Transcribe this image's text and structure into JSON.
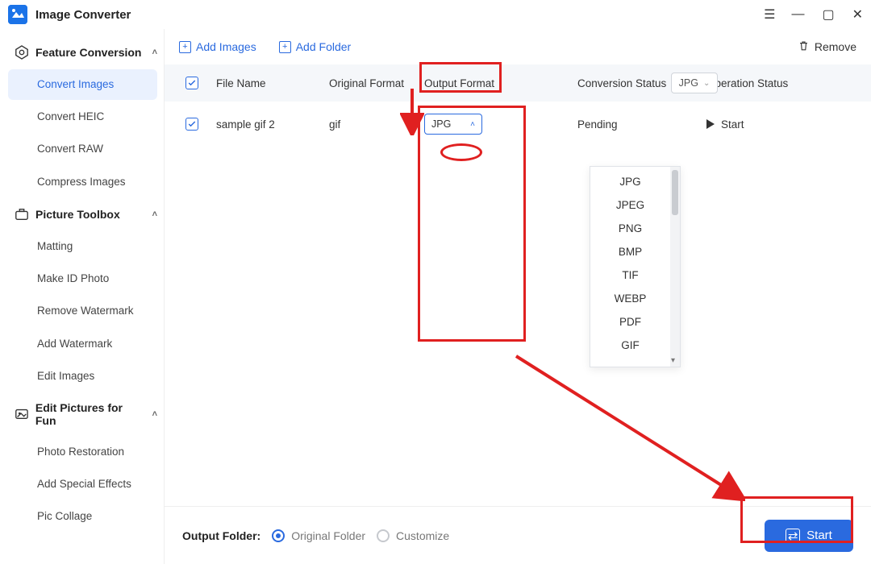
{
  "app": {
    "title": "Image Converter"
  },
  "sidebar": {
    "groups": [
      {
        "label": "Feature Conversion",
        "items": [
          "Convert Images",
          "Convert HEIC",
          "Convert RAW",
          "Compress Images"
        ],
        "active_index": 0
      },
      {
        "label": "Picture Toolbox",
        "items": [
          "Matting",
          "Make ID Photo",
          "Remove Watermark",
          "Add Watermark",
          "Edit Images"
        ]
      },
      {
        "label": "Edit Pictures for Fun",
        "items": [
          "Photo Restoration",
          "Add Special Effects",
          "Pic Collage"
        ]
      }
    ]
  },
  "toolbar": {
    "add_images": "Add Images",
    "add_folder": "Add Folder",
    "remove": "Remove"
  },
  "table": {
    "headers": {
      "file_name": "File Name",
      "original_format": "Original Format",
      "output_format": "Output Format",
      "conversion_status": "Conversion Status",
      "operation_status": "Operation Status"
    },
    "header_select_value": "JPG",
    "rows": [
      {
        "file_name": "sample gif 2",
        "original_format": "gif",
        "output_select": "JPG",
        "conversion_status": "Pending",
        "operation_label": "Start"
      }
    ]
  },
  "dropdown": {
    "options": [
      "JPG",
      "JPEG",
      "PNG",
      "BMP",
      "TIF",
      "WEBP",
      "PDF",
      "GIF"
    ],
    "selected": "JPG"
  },
  "bottom": {
    "label": "Output Folder:",
    "option_original": "Original Folder",
    "option_customize": "Customize",
    "start": "Start"
  },
  "colors": {
    "accent": "#2a6adf",
    "annotation": "#e02020"
  }
}
